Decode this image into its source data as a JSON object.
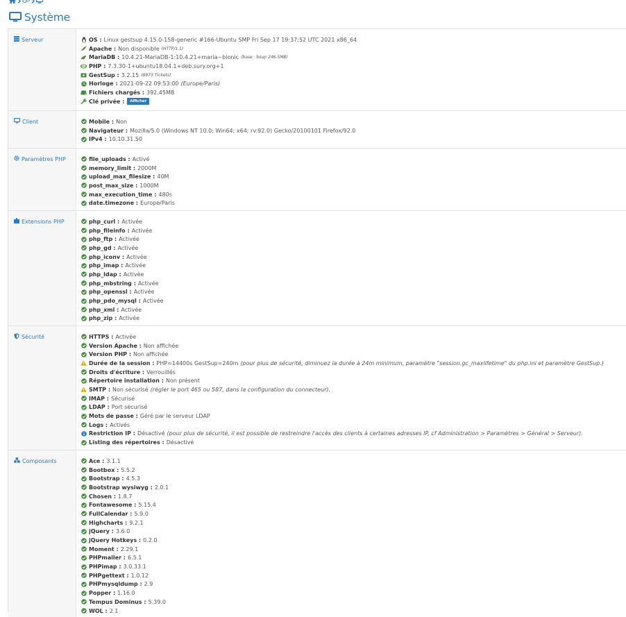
{
  "page": {
    "title": "Système"
  },
  "colors": {
    "accent": "#2a7cc0",
    "ok": "#3e8e3a",
    "warn": "#e6a800",
    "info": "#2a7cc0"
  },
  "sections": {
    "serveur": {
      "label": "Serveur",
      "rows": [
        {
          "key": "OS :",
          "value": "Linux gestsup 4.15.0-158-generic #166-Ubuntu SMP Fri Sep 17 19:37:52 UTC 2021 x86_64"
        },
        {
          "key": "Apache :",
          "value": "Non disponible",
          "note": "(HTTP/1.1)"
        },
        {
          "key": "MariaDB :",
          "value": "10.4.21-MariaDB-1:10.4.21+maria~bionic",
          "note": "(base : bsup 246.5MB)"
        },
        {
          "key": "PHP :",
          "value": "7.3.30-1+ubuntu18.04.1+deb.sury.org+1"
        },
        {
          "key": "GestSup :",
          "value": "3.2.15",
          "note": "(8873 Tickets)"
        },
        {
          "key": "Horloge :",
          "value": "2021-09-22 09:53:00",
          "note": "(Europe/Paris)"
        },
        {
          "key": "Fichiers chargés :",
          "value": "392.45MB"
        },
        {
          "key": "Clé privée :",
          "button": "Afficher"
        }
      ]
    },
    "client": {
      "label": "Client",
      "rows": [
        {
          "key": "Mobile :",
          "value": "Non"
        },
        {
          "key": "Navigateur :",
          "value": "Mozilla/5.0 (Windows NT 10.0; Win64; x64; rv:92.0) Gecko/20100101 Firefox/92.0"
        },
        {
          "key": "IPv4 :",
          "value": "10.10.31.50"
        }
      ]
    },
    "php": {
      "label": "Paramètres PHP",
      "rows": [
        {
          "key": "file_uploads :",
          "value": "Activé"
        },
        {
          "key": "memory_limit :",
          "value": "2000M"
        },
        {
          "key": "upload_max_filesize :",
          "value": "40M"
        },
        {
          "key": "post_max_size :",
          "value": "1000M"
        },
        {
          "key": "max_execution_time :",
          "value": "480s"
        },
        {
          "key": "date.timezone :",
          "value": "Europe/Paris"
        }
      ]
    },
    "ext": {
      "label": "Extensions PHP",
      "rows": [
        {
          "key": "php_curl :",
          "value": "Activée"
        },
        {
          "key": "php_fileinfo :",
          "value": "Activée"
        },
        {
          "key": "php_ftp :",
          "value": "Activée"
        },
        {
          "key": "php_gd :",
          "value": "Activée"
        },
        {
          "key": "php_iconv :",
          "value": "Activée"
        },
        {
          "key": "php_imap :",
          "value": "Activée"
        },
        {
          "key": "php_ldap :",
          "value": "Activée"
        },
        {
          "key": "php_mbstring :",
          "value": "Activée"
        },
        {
          "key": "php_openssl :",
          "value": "Activée"
        },
        {
          "key": "php_pdo_mysql :",
          "value": "Activée"
        },
        {
          "key": "php_xml :",
          "value": "Activée"
        },
        {
          "key": "php_zip :",
          "value": "Activée"
        }
      ]
    },
    "secu": {
      "label": "Sécurité",
      "rows": [
        {
          "key": "HTTPS :",
          "value": "Activée"
        },
        {
          "key": "Version Apache :",
          "value": "Non affichée"
        },
        {
          "key": "Version PHP :",
          "value": "Non affichée"
        },
        {
          "key": "Durée de la session :",
          "value": "PHP=14400s GestSup=240m",
          "note": "(pour plus de sécurité, diminuez la durée à 24m minimum, paramètre \"session.gc_maxlifetime\" du php.ini et paramètre GestSup.)"
        },
        {
          "key": "Droits d'écriture :",
          "value": "Verrouillés"
        },
        {
          "key": "Répertoire installation :",
          "value": "Non présent"
        },
        {
          "key": "SMTP :",
          "value": "Non sécurisé",
          "note": "(régler le port 465 ou 587, dans la configuration du connecteur)."
        },
        {
          "key": "IMAP :",
          "value": "Sécurisé"
        },
        {
          "key": "LDAP :",
          "value": "Port sécurisé"
        },
        {
          "key": "Mots de passe :",
          "value": "Géré par le serveur LDAP"
        },
        {
          "key": "Logs :",
          "value": "Activés"
        },
        {
          "key": "Restriction IP :",
          "value": "Désactivé",
          "note": "(pour plus de sécurité, il est possible de restreindre l'accès des clients à certaines adresses IP, cf Administration > Paramètres > Général > Serveur)."
        },
        {
          "key": "Listing des répertoires :",
          "value": "Désactivé"
        }
      ]
    },
    "comp": {
      "label": "Composants",
      "rows": [
        {
          "key": "Ace :",
          "value": "3.1.1"
        },
        {
          "key": "Bootbox :",
          "value": "5.5.2"
        },
        {
          "key": "Bootstrap :",
          "value": "4.5.3"
        },
        {
          "key": "Bootstrap wysiwyg :",
          "value": "2.0.1"
        },
        {
          "key": "Chosen :",
          "value": "1.8.7"
        },
        {
          "key": "Fontawesome :",
          "value": "5.15.4"
        },
        {
          "key": "FullCalendar :",
          "value": "5.9.0"
        },
        {
          "key": "Highcharts :",
          "value": "9.2.1"
        },
        {
          "key": "jQuery :",
          "value": "3.6.0"
        },
        {
          "key": "jQuery Hotkeys :",
          "value": "0.2.0"
        },
        {
          "key": "Moment :",
          "value": "2.29.1"
        },
        {
          "key": "PHPmailer :",
          "value": "6.5.1"
        },
        {
          "key": "PHPimap :",
          "value": "3.0.33.1"
        },
        {
          "key": "PHPgettext :",
          "value": "1.0.12"
        },
        {
          "key": "PHPmysqldump :",
          "value": "2.9"
        },
        {
          "key": "Popper :",
          "value": "1.16.0"
        },
        {
          "key": "Tempus Dominus :",
          "value": "5.39.0"
        },
        {
          "key": "WOL :",
          "value": "2.1"
        }
      ]
    }
  }
}
